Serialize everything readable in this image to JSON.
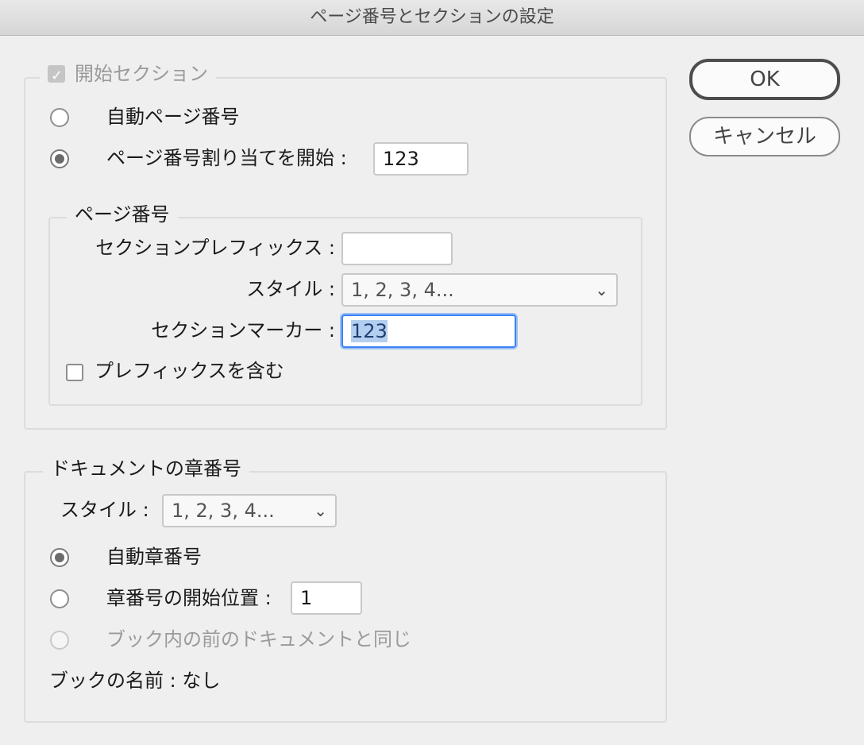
{
  "window": {
    "title": "ページ番号とセクションの設定"
  },
  "start_section": {
    "legend": "開始セクション",
    "auto_page_label": "自動ページ番号",
    "start_page_label": "ページ番号割り当てを開始 :",
    "start_page_value": "123",
    "page_numbering": {
      "legend": "ページ番号",
      "prefix_label": "セクションプレフィックス :",
      "prefix_value": "",
      "style_label": "スタイル :",
      "style_value": "1, 2, 3, 4...",
      "marker_label": "セクションマーカー :",
      "marker_value": "123",
      "include_prefix_label": "プレフィックスを含む"
    }
  },
  "chapter": {
    "legend": "ドキュメントの章番号",
    "style_label": "スタイル :",
    "style_value": "1, 2, 3, 4...",
    "auto_label": "自動章番号",
    "start_label": "章番号の開始位置 :",
    "start_value": "1",
    "same_as_prev_label": "ブック内の前のドキュメントと同じ",
    "book_name_label": "ブックの名前 : なし"
  },
  "buttons": {
    "ok": "OK",
    "cancel": "キャンセル"
  }
}
